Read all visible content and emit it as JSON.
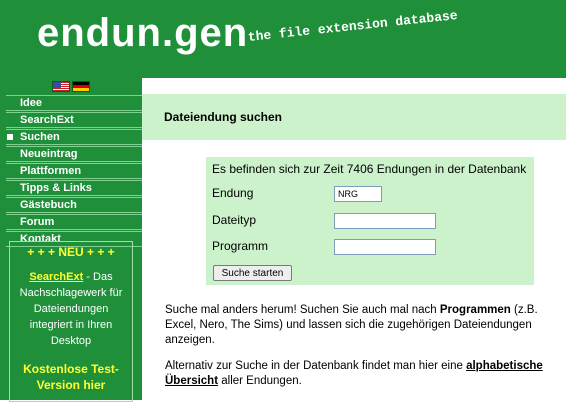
{
  "header": {
    "title": "endun.gen",
    "tagline": "the file extension database"
  },
  "colors": {
    "brand_green": "#1f8f3a",
    "light_green": "#ccf2cc",
    "promo_yellow": "#ffff33"
  },
  "languages": {
    "flags": [
      "us-flag-icon",
      "de-flag-icon"
    ]
  },
  "nav": {
    "items": [
      {
        "label": "Idee"
      },
      {
        "label": "SearchExt"
      },
      {
        "label": "Suchen",
        "active": true
      },
      {
        "label": "Neueintrag"
      },
      {
        "label": "Plattformen"
      },
      {
        "label": "Tipps & Links"
      },
      {
        "label": "Gästebuch"
      },
      {
        "label": "Forum"
      },
      {
        "label": "Kontakt"
      }
    ]
  },
  "promo": {
    "headline": "+ + + NEU + + +",
    "link": "SearchExt",
    "text": " - Das Nachschlagewerk für Dateiendungen integriert in Ihren Desktop",
    "cta": "Kostenlose Test-Version hier"
  },
  "section": {
    "title": "Dateiendung suchen"
  },
  "search_form": {
    "info": "Es befinden sich zur Zeit 7406 Endungen in der Datenbank",
    "endung_label": "Endung",
    "endung_value": "NRG",
    "dateityp_label": "Dateityp",
    "dateityp_value": "",
    "programm_label": "Programm",
    "programm_value": "",
    "submit_label": "Suche starten"
  },
  "text": {
    "p1_a": "Suche mal anders herum! Suchen Sie auch mal nach ",
    "p1_bold": "Programmen",
    "p1_b": " (z.B. Excel, Nero, The Sims) und lassen sich die zugehörigen Dateiendungen anzeigen.",
    "p2_a": "Alternativ zur Suche in der Datenbank findet man hier eine ",
    "p2_link": "alphabetische Übersicht",
    "p2_b": " aller Endungen."
  }
}
